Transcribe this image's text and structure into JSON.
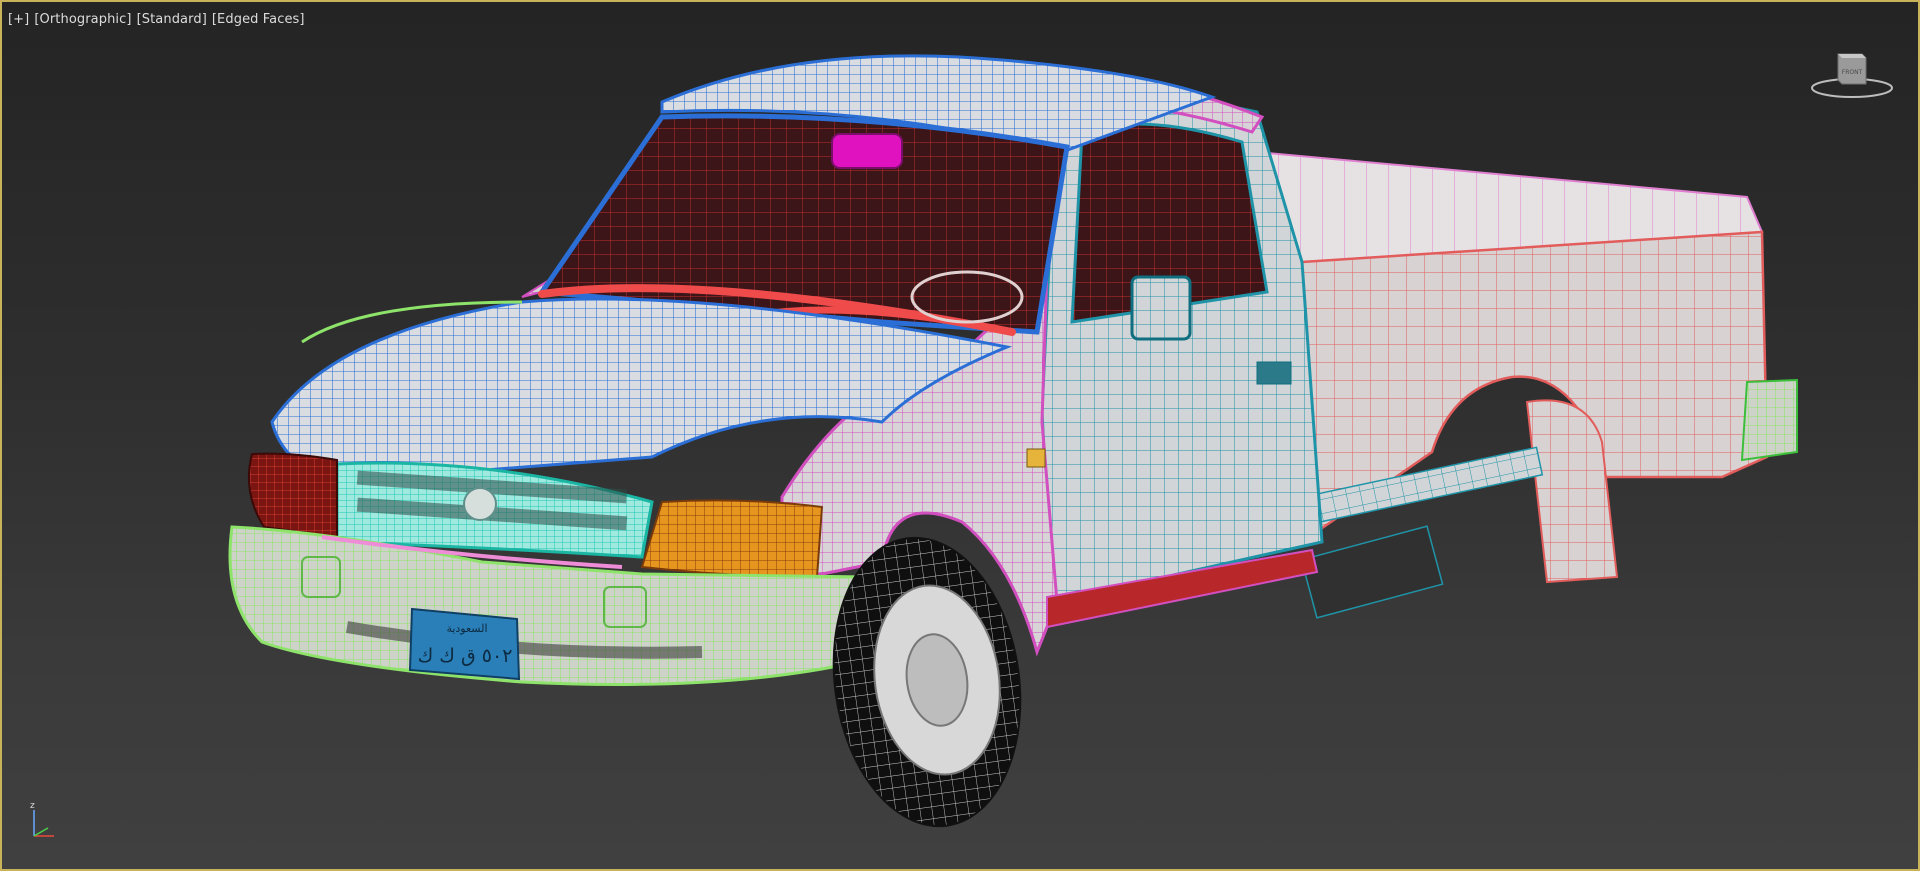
{
  "viewport": {
    "labels": {
      "plus": "[+]",
      "projection": "[Orthographic]",
      "shading": "[Standard]",
      "display": "[Edged Faces]"
    },
    "viewcube": {
      "face_label": "FRONT",
      "icon": "viewcube-icon"
    },
    "axis_gizmo": {
      "z_label": "z",
      "icon": "axis-tripod-icon"
    }
  },
  "scene": {
    "object": "pickup-truck-wireframe-model",
    "license_plate": {
      "line1": "السعودية",
      "line2": "٥٠٢ ق ك ك"
    }
  },
  "colors": {
    "border": "#c8b25a",
    "body_blue": "#2b6fd6",
    "body_magenta": "#d24fc0",
    "body_teal": "#1f94a8",
    "body_red": "#e35c5c",
    "bumper_green": "#8ee36a",
    "grille_cyan": "#5fe8d6",
    "headlight_orange": "#e0881e",
    "taillight_red": "#b3201f"
  }
}
